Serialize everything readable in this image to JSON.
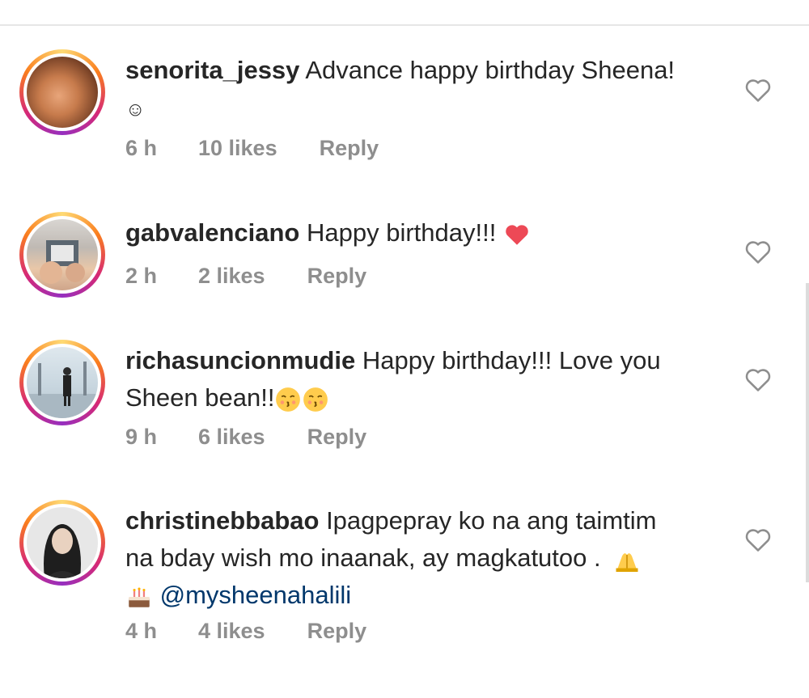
{
  "comments": [
    {
      "username": "senorita_jessy",
      "text": "Advance happy birthday Sheena!",
      "continuation": "☺",
      "time": "6 h",
      "likes": "10 likes",
      "reply": "Reply"
    },
    {
      "username": "gabvalenciano",
      "text": "Happy birthday!!!",
      "time": "2 h",
      "likes": "2 likes",
      "reply": "Reply"
    },
    {
      "username": "richasuncionmudie",
      "text": "Happy birthday!!! Love you",
      "continuation": "Sheen bean!!",
      "time": "9 h",
      "likes": "6 likes",
      "reply": "Reply"
    },
    {
      "username": "christinebbabao",
      "text": "Ipagpepray ko na ang taimtim",
      "line2": "na bday wish mo inaanak, ay magkatutoo .",
      "mention": "@mysheenahalili",
      "time": "4 h",
      "likes": "4 likes",
      "reply": "Reply"
    }
  ],
  "icons": {
    "like": "heart-outline-icon",
    "red_heart": "red-heart-emoji",
    "kiss_face": "kissing-face-emoji",
    "pray": "folded-hands-emoji",
    "cake": "birthday-cake-emoji"
  },
  "colors": {
    "text": "#262626",
    "meta": "#8e8e8e",
    "mention": "#00376b",
    "heart_red": "#ed4956"
  }
}
